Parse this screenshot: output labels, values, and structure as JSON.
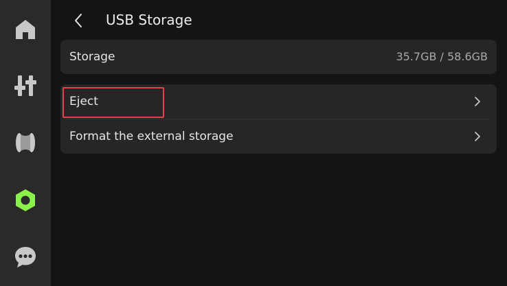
{
  "sidebar": {
    "items": [
      {
        "icon": "home-icon",
        "active": false
      },
      {
        "icon": "sliders-icon",
        "active": false
      },
      {
        "icon": "filament-spool-icon",
        "active": false
      },
      {
        "icon": "settings-hex-nut-icon",
        "active": true
      },
      {
        "icon": "chat-bubble-icon",
        "active": false
      }
    ],
    "active_color": "#8cf04a",
    "inactive_color": "#c8c8c8"
  },
  "header": {
    "title": "USB Storage",
    "back_icon": "chevron-left-icon"
  },
  "storage": {
    "label": "Storage",
    "value": "35.7GB / 58.6GB"
  },
  "actions": [
    {
      "label": "Eject",
      "icon": "chevron-right-icon"
    },
    {
      "label": "Format the external storage",
      "icon": "chevron-right-icon"
    }
  ],
  "colors": {
    "background": "#141414",
    "sidebar": "#2a2a2a",
    "card": "#262626",
    "highlight": "#e0454b"
  }
}
